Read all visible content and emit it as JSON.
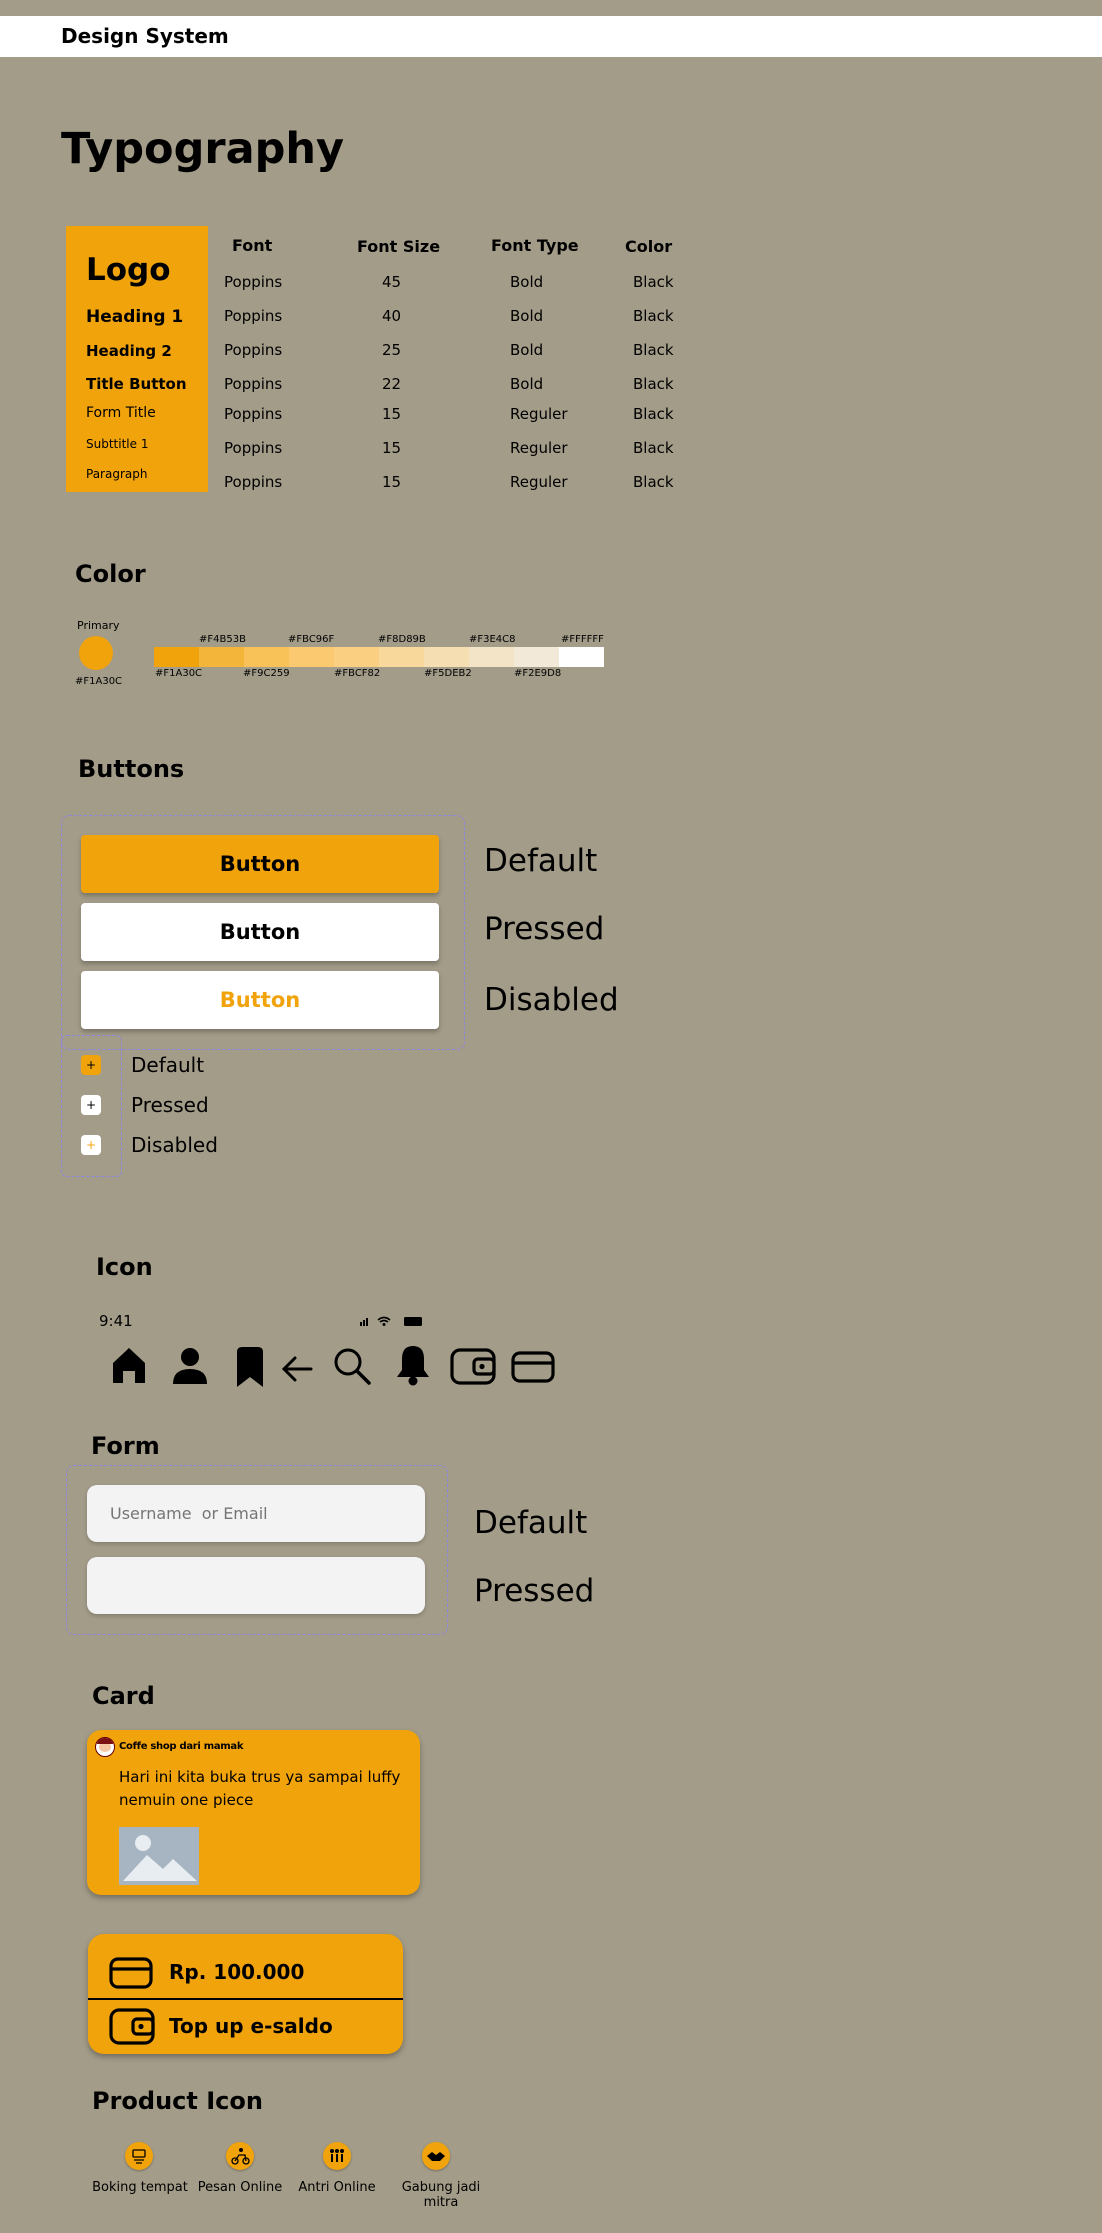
{
  "header": {
    "title": "Design System"
  },
  "typography": {
    "heading": "Typography",
    "styles": [
      "Logo",
      "Heading 1",
      "Heading 2",
      "Title Button",
      "Form Title",
      "Subttitle 1",
      "Paragraph"
    ],
    "columns": [
      "Font",
      "Font Size",
      "Font Type",
      "Color"
    ],
    "rows": [
      [
        "Poppins",
        "45",
        "Bold",
        "Black"
      ],
      [
        "Poppins",
        "40",
        "Bold",
        "Black"
      ],
      [
        "Poppins",
        "25",
        "Bold",
        "Black"
      ],
      [
        "Poppins",
        "22",
        "Bold",
        "Black"
      ],
      [
        "Poppins",
        "15",
        "Reguler",
        "Black"
      ],
      [
        "Poppins",
        "15",
        "Reguler",
        "Black"
      ],
      [
        "Poppins",
        "15",
        "Reguler",
        "Black"
      ]
    ]
  },
  "color": {
    "heading": "Color",
    "primary_label": "Primary",
    "primary_hex": "#F1A30C",
    "swatches": [
      "#F1A30C",
      "#F4B53B",
      "#F9C259",
      "#FBC96F",
      "#FBCF82",
      "#F8D89B",
      "#F5DEB2",
      "#F3E4C8",
      "#F2E9D8",
      "#FFFFFF"
    ],
    "top_labels": [
      "#F4B53B",
      "#FBC96F",
      "#F8D89B",
      "#F3E4C8",
      "#FFFFFF"
    ],
    "bottom_labels": [
      "#F1A30C",
      "#F9C259",
      "#FBCF82",
      "#F5DEB2",
      "#F2E9D8"
    ]
  },
  "buttons": {
    "heading": "Buttons",
    "label": "Button",
    "states": [
      "Default",
      "Pressed",
      "Disabled"
    ],
    "mini_glyph": "+"
  },
  "icon": {
    "heading": "Icon",
    "time": "9:41",
    "names": [
      "home-icon",
      "user-icon",
      "bookmark-icon",
      "arrow-left-icon",
      "search-icon",
      "bell-icon",
      "wallet-icon",
      "card-icon"
    ]
  },
  "form": {
    "heading": "Form",
    "placeholder": "Username  or Email",
    "states": [
      "Default",
      "Pressed"
    ]
  },
  "card": {
    "heading": "Card",
    "author": "Coffe shop dari mamak",
    "text": "Hari ini  kita buka trus ya sampai luffy nemuin one piece"
  },
  "wallet": {
    "balance": "Rp. 100.000",
    "topup": "Top up e-saldo"
  },
  "product_icon": {
    "heading": "Product Icon",
    "items": [
      "Boking tempat",
      "Pesan Online",
      "Antri Online",
      "Gabung jadi mitra"
    ]
  },
  "colors": {
    "primary": "#F1A30C",
    "background": "#A39C89",
    "disabled_text": "#F1A30C"
  }
}
